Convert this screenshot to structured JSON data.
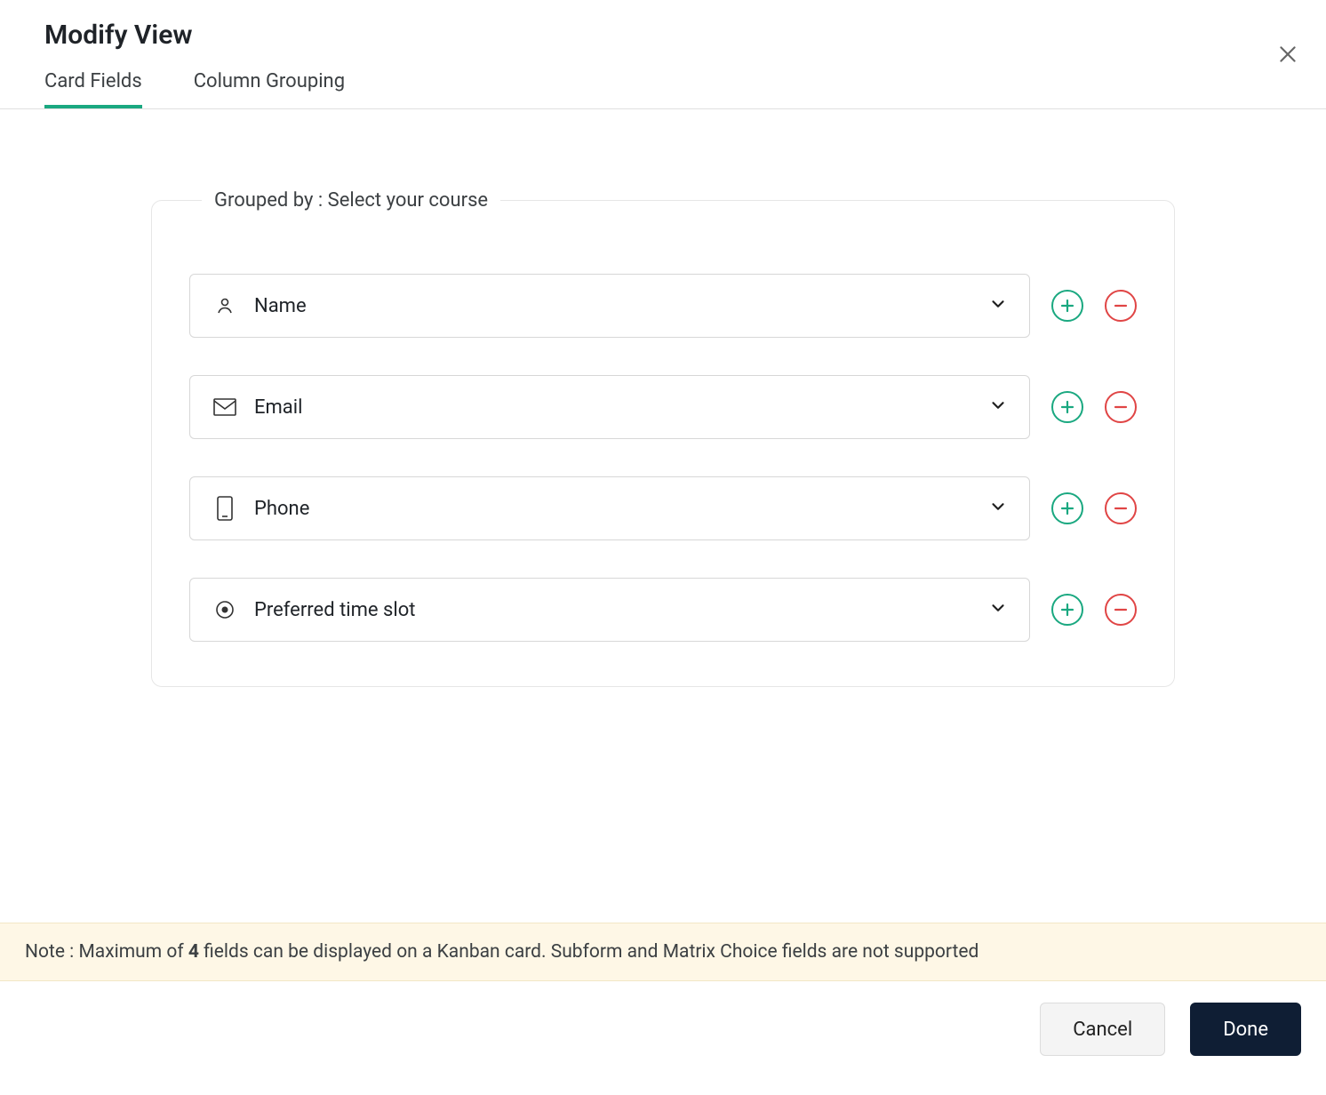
{
  "dialog": {
    "title": "Modify View"
  },
  "tabs": {
    "card_fields": "Card Fields",
    "column_grouping": "Column Grouping"
  },
  "group": {
    "legend": "Grouped by : Select your course"
  },
  "fields": [
    {
      "label": "Name",
      "icon": "person-icon"
    },
    {
      "label": "Email",
      "icon": "mail-icon"
    },
    {
      "label": "Phone",
      "icon": "phone-device-icon"
    },
    {
      "label": "Preferred time slot",
      "icon": "radio-icon"
    }
  ],
  "note": {
    "prefix": "Note : Maximum of ",
    "count": "4",
    "suffix": " fields can be displayed on a Kanban card. Subform and Matrix Choice fields are not supported"
  },
  "footer": {
    "cancel": "Cancel",
    "done": "Done"
  }
}
